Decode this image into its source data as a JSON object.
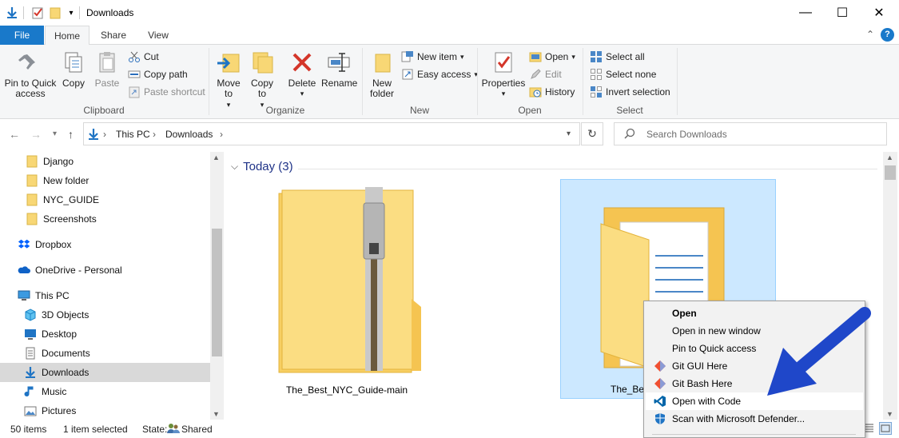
{
  "window": {
    "title": "Downloads",
    "controls": {
      "minimize": "—",
      "maximize": "☐",
      "close": "✕"
    }
  },
  "ribbon_tabs": [
    "File",
    "Home",
    "Share",
    "View"
  ],
  "ribbon": {
    "clipboard": {
      "label": "Clipboard",
      "pin": "Pin to Quick access",
      "copy": "Copy",
      "paste": "Paste",
      "cut": "Cut",
      "copy_path": "Copy path",
      "paste_shortcut": "Paste shortcut"
    },
    "organize": {
      "label": "Organize",
      "move_to": "Move to",
      "copy_to": "Copy to",
      "delete": "Delete",
      "rename": "Rename"
    },
    "new": {
      "label": "New",
      "new_folder": "New folder",
      "new_item": "New item",
      "easy_access": "Easy access"
    },
    "open": {
      "label": "Open",
      "properties": "Properties",
      "open": "Open",
      "edit": "Edit",
      "history": "History"
    },
    "select": {
      "label": "Select",
      "select_all": "Select all",
      "select_none": "Select none",
      "invert": "Invert selection"
    }
  },
  "address": {
    "crumbs": [
      "This PC",
      "Downloads"
    ],
    "search_placeholder": "Search Downloads"
  },
  "nav_pane": {
    "items": [
      {
        "label": "Django",
        "icon": "folder-icon"
      },
      {
        "label": "New folder",
        "icon": "folder-icon"
      },
      {
        "label": "NYC_GUIDE",
        "icon": "folder-icon"
      },
      {
        "label": "Screenshots",
        "icon": "folder-icon"
      },
      {
        "label": "Dropbox",
        "icon": "dropbox-icon"
      },
      {
        "label": "OneDrive - Personal",
        "icon": "onedrive-icon"
      },
      {
        "label": "This PC",
        "icon": "this-pc-icon"
      },
      {
        "label": "3D Objects",
        "icon": "3d-objects-icon"
      },
      {
        "label": "Desktop",
        "icon": "desktop-icon"
      },
      {
        "label": "Documents",
        "icon": "documents-icon"
      },
      {
        "label": "Downloads",
        "icon": "downloads-icon"
      },
      {
        "label": "Music",
        "icon": "music-icon"
      },
      {
        "label": "Pictures",
        "icon": "pictures-icon"
      }
    ]
  },
  "content": {
    "group_header": "Today (3)",
    "files": [
      {
        "name": "The_Best_NYC_Guide-main",
        "type": "zip-folder"
      },
      {
        "name": "The_Bes",
        "type": "folder"
      }
    ]
  },
  "status_bar": {
    "item_count": "50 items",
    "selection": "1 item selected",
    "state_label": "State:",
    "state_value": "Shared"
  },
  "context_menu": {
    "items": [
      {
        "label": "Open",
        "bold": true
      },
      {
        "label": "Open in new window"
      },
      {
        "label": "Pin to Quick access"
      },
      {
        "label": "Git GUI Here",
        "icon": "git-gui-icon"
      },
      {
        "label": "Git Bash Here",
        "icon": "git-bash-icon"
      },
      {
        "label": "Open with Code",
        "icon": "vscode-icon"
      },
      {
        "label": "Scan with Microsoft Defender...",
        "icon": "defender-icon"
      }
    ]
  },
  "colors": {
    "accent": "#1979ca",
    "selection": "#cce8ff",
    "folder": "#f8d775",
    "annotation_arrow": "#1f47c9"
  }
}
